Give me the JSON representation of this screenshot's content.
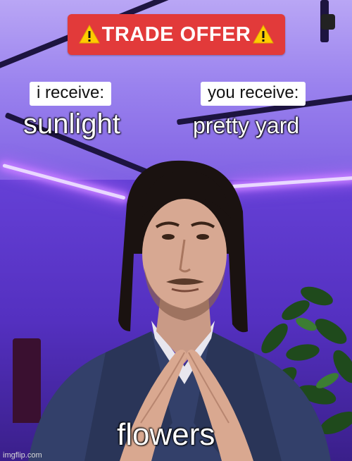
{
  "banner": {
    "text": "TRADE OFFER",
    "icon": "warning-icon"
  },
  "labels": {
    "i_receive": "i receive:",
    "you_receive": "you receive:"
  },
  "captions": {
    "i_receive_item": "sunlight",
    "you_receive_item": "pretty yard",
    "bottom": "flowers"
  },
  "watermark": "imgflip.com",
  "colors": {
    "banner": "#e23a3a",
    "background": "#6b48dc",
    "led": "#c07bff"
  }
}
